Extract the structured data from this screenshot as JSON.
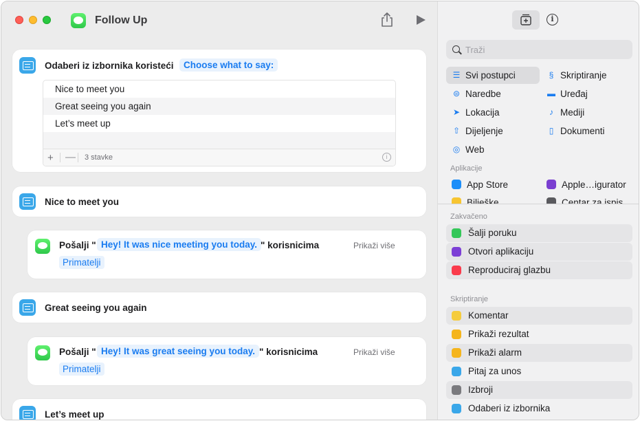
{
  "window": {
    "title": "Follow Up"
  },
  "editor": {
    "choose_action": {
      "label": "Odaberi iz izbornika koristeći",
      "prompt_token": "Choose what to say:",
      "items": [
        "Nice to meet you",
        "Great seeing you again",
        "Let’s meet up"
      ],
      "count_label": "3 stavke",
      "add_label": "+",
      "remove_label": "—"
    },
    "sections": [
      {
        "title": "Nice to meet you",
        "send": {
          "prefix": "Pošalji \"",
          "message": "Hey! It was nice meeting you today.",
          "suffix": "\" korisnicima",
          "recipients": "Primatelji",
          "show_more": "Prikaži više"
        }
      },
      {
        "title": "Great seeing you again",
        "send": {
          "prefix": "Pošalji \"",
          "message": "Hey! It was great seeing you today.",
          "suffix": "\" korisnicima",
          "recipients": "Primatelji",
          "show_more": "Prikaži više"
        }
      },
      {
        "title": "Let’s meet up"
      }
    ]
  },
  "sidebar": {
    "search_placeholder": "Traži",
    "info_glyph": "i",
    "categories": [
      {
        "label": "Svi postupci",
        "icon": "list-icon",
        "selected": true
      },
      {
        "label": "Skriptiranje",
        "icon": "script-icon",
        "selected": false
      },
      {
        "label": "Naredbe",
        "icon": "toggles-icon",
        "selected": false
      },
      {
        "label": "Uređaj",
        "icon": "monitor-icon",
        "selected": false
      },
      {
        "label": "Lokacija",
        "icon": "location-arrow-icon",
        "selected": false
      },
      {
        "label": "Mediji",
        "icon": "music-note-icon",
        "selected": false
      },
      {
        "label": "Dijeljenje",
        "icon": "share-icon",
        "selected": false
      },
      {
        "label": "Dokumenti",
        "icon": "document-icon",
        "selected": false
      },
      {
        "label": "Web",
        "icon": "compass-icon",
        "selected": false
      }
    ],
    "apps_header": "Aplikacije",
    "apps": [
      {
        "label": "App Store",
        "color": "#1c8ef9"
      },
      {
        "label": "Apple…igurator",
        "color": "#7a3fd1"
      },
      {
        "label": "Bilješke",
        "color": "#f7c531"
      },
      {
        "label": "Centar za ispis",
        "color": "#5a5a5e"
      }
    ],
    "pinned_header": "Zakvačeno",
    "pinned": [
      {
        "label": "Šalji poruku",
        "color": "#34c759"
      },
      {
        "label": "Otvori aplikaciju",
        "color": "#7c3fd6"
      },
      {
        "label": "Reproduciraj glazbu",
        "color": "#fa3b4c"
      }
    ],
    "scripting_header": "Skriptiranje",
    "scripting": [
      {
        "label": "Komentar",
        "color": "#f5cc3d",
        "highlight": true
      },
      {
        "label": "Prikaži rezultat",
        "color": "#f5b51d",
        "highlight": false
      },
      {
        "label": "Prikaži alarm",
        "color": "#f5b51d",
        "highlight": true
      },
      {
        "label": "Pitaj za unos",
        "color": "#3aa7e9",
        "highlight": false
      },
      {
        "label": "Izbroji",
        "color": "#7a7a7e",
        "highlight": true
      },
      {
        "label": "Odaberi iz izbornika",
        "color": "#3aa7e9",
        "highlight": false
      }
    ]
  }
}
